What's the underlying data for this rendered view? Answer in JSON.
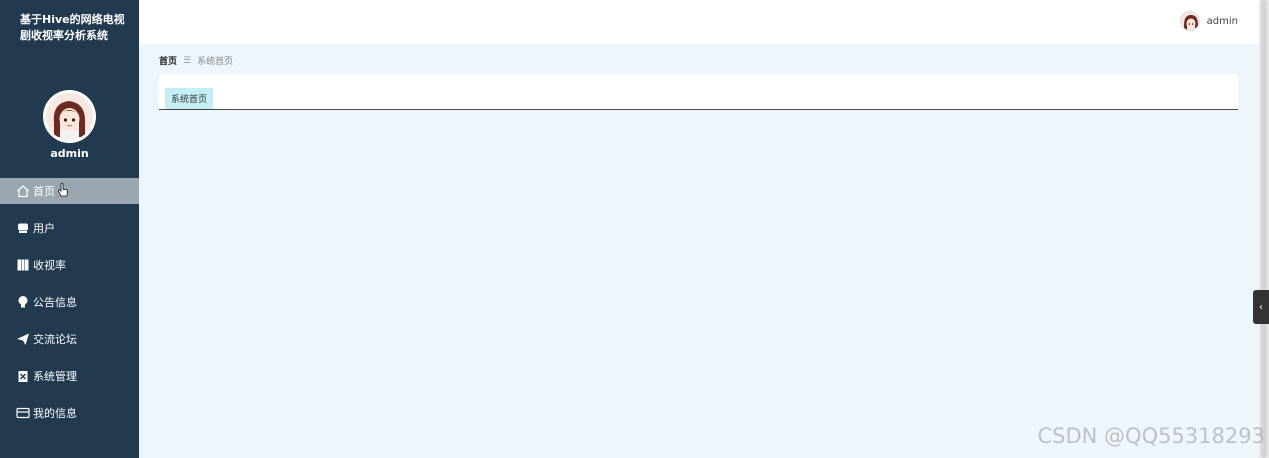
{
  "sidebar": {
    "app_title": "基于Hive的网络电视剧收视率分析系统",
    "username": "admin",
    "items": [
      {
        "label": "首页",
        "icon": "home-icon"
      },
      {
        "label": "用户",
        "icon": "user-icon"
      },
      {
        "label": "收视率",
        "icon": "book-icon"
      },
      {
        "label": "公告信息",
        "icon": "bulb-icon"
      },
      {
        "label": "交流论坛",
        "icon": "paper-plane-icon"
      },
      {
        "label": "系统管理",
        "icon": "clipboard-icon"
      },
      {
        "label": "我的信息",
        "icon": "card-icon"
      }
    ],
    "active_index": 0
  },
  "topbar": {
    "username": "admin"
  },
  "breadcrumb": {
    "home": "首页",
    "separator": "☰",
    "current": "系统首页"
  },
  "panel": {
    "tab_label": "系统首页"
  },
  "watermark": "CSDN @QQ55318293",
  "colors": {
    "sidebar_bg": "#213a4f",
    "active_item_bg": "#9aa7b0",
    "main_bg": "#eef6fd",
    "tab_bg": "#c4eef6"
  }
}
